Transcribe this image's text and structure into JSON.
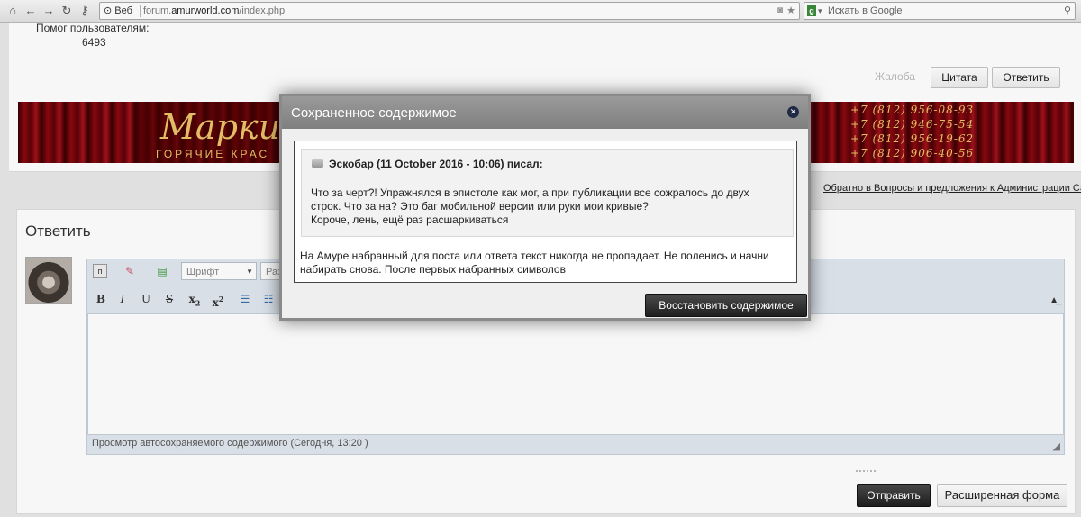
{
  "browser": {
    "web_label": "Веб",
    "url_prefix": "forum.",
    "url_domain": "amurworld.com",
    "url_path": "/index.php",
    "search_placeholder": "Искать в Google"
  },
  "post": {
    "help_label": "Помог пользователям:",
    "help_count": "6493",
    "report_label": "Жалоба",
    "quote_button": "Цитата",
    "reply_button": "Ответить"
  },
  "banner": {
    "title": "Марки",
    "subtitle": "ГОРЯЧИЕ КРАС",
    "phones": [
      "+7 (812) 956-08-93",
      "+7 (812) 946-75-54",
      "+7 (812) 956-19-62",
      "+7 (812) 906-40-56"
    ]
  },
  "back_link": "Обратно в Вопросы и предложения к Администрации Сайта",
  "reply": {
    "title": "Ответить",
    "font_select": "Шрифт",
    "size_select": "Раз",
    "autosave_note": "Просмотр автосохраняемого содержимого (Сегодня, 13:20 )",
    "send_button": "Отправить",
    "advanced_button": "Расширенная форма"
  },
  "modal": {
    "title": "Сохраненное содержимое",
    "quote_author": "Эскобар (11 October 2016 - 10:06) писал:",
    "quote_lines": [
      "Что за черт?! Упражнялся в эпистоле как мог, а при публикации все сожралось до двух",
      "строк. Что за на? Это баг мобильной версии или руки мои кривые?",
      "Короче, лень, ещё раз расшаркиваться"
    ],
    "text_lines": [
      "На Амуре набранный для поста или ответа текст никогда не пропадает. Не поленись и начни",
      "набирать снова. После первых набранных символов"
    ],
    "restore_button": "Восстановить содержимое"
  }
}
